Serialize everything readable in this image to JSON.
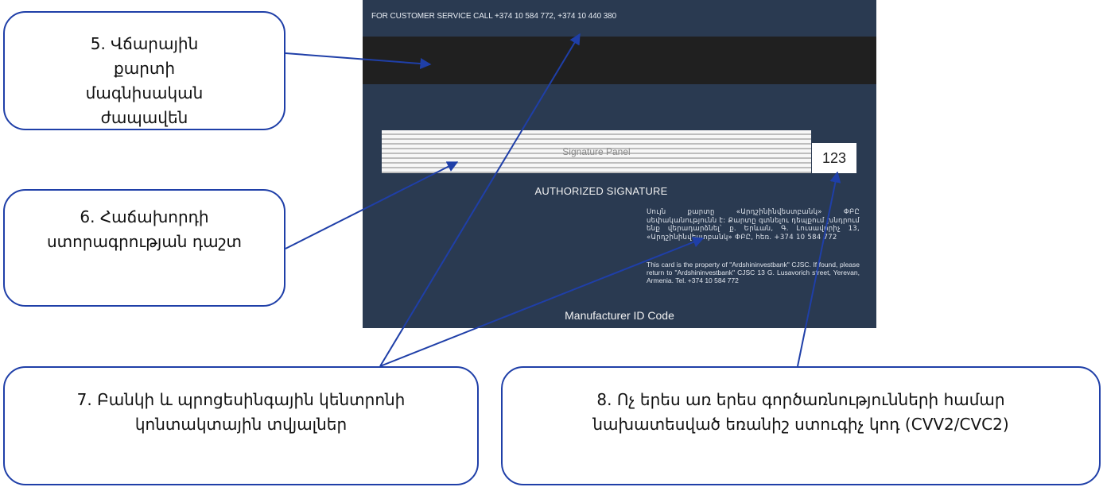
{
  "callouts": {
    "c5": "5. Վճարային քարտի մագնիսական ժապավեն",
    "c6": "6. Հաճախորդի ստորագրության դաշտ",
    "c7": "7. Բանկի և պրոցեսինգային կենտրոնի կոնտակտային տվյալներ",
    "c8": "8. Ոչ երես առ երես գործառնությունների համար նախատեսված եռանիշ ստուգիչ կոդ (CVV2/CVC2)"
  },
  "card": {
    "service_line": "FOR CUSTOMER SERVICE CALL +374 10 584 772, +374 10 440 380",
    "signature_label": "Signature Panel",
    "cvv": "123",
    "authorized": "AUTHORIZED SIGNATURE",
    "armenian_text": "Սույն քարտը «Արդշինինվեստբանկ» ՓԲԸ սեփականությունն է: Քարտը գտնելու դեպքում խնդրում ենք վերադարձնել՝ ք. Երևան, Գ. Լուսավորիչ 13, «Արդշինինվեստբանկ» ՓԲԸ, հեռ. +374 10 584 772",
    "english_text": "This card is the property of \"Ardshininvestbank\" CJSC. If found, please return to \"Ardshininvestbank\" CJSC 13 G. Lusavorich street, Yerevan, Armenia. Tel. +374 10 584 772",
    "manufacturer": "Manufacturer ID Code"
  },
  "colors": {
    "card_bg": "#2a3a51",
    "stripe": "#202020",
    "callout_border": "#1f3fa8",
    "arrow": "#1f3fa8"
  }
}
